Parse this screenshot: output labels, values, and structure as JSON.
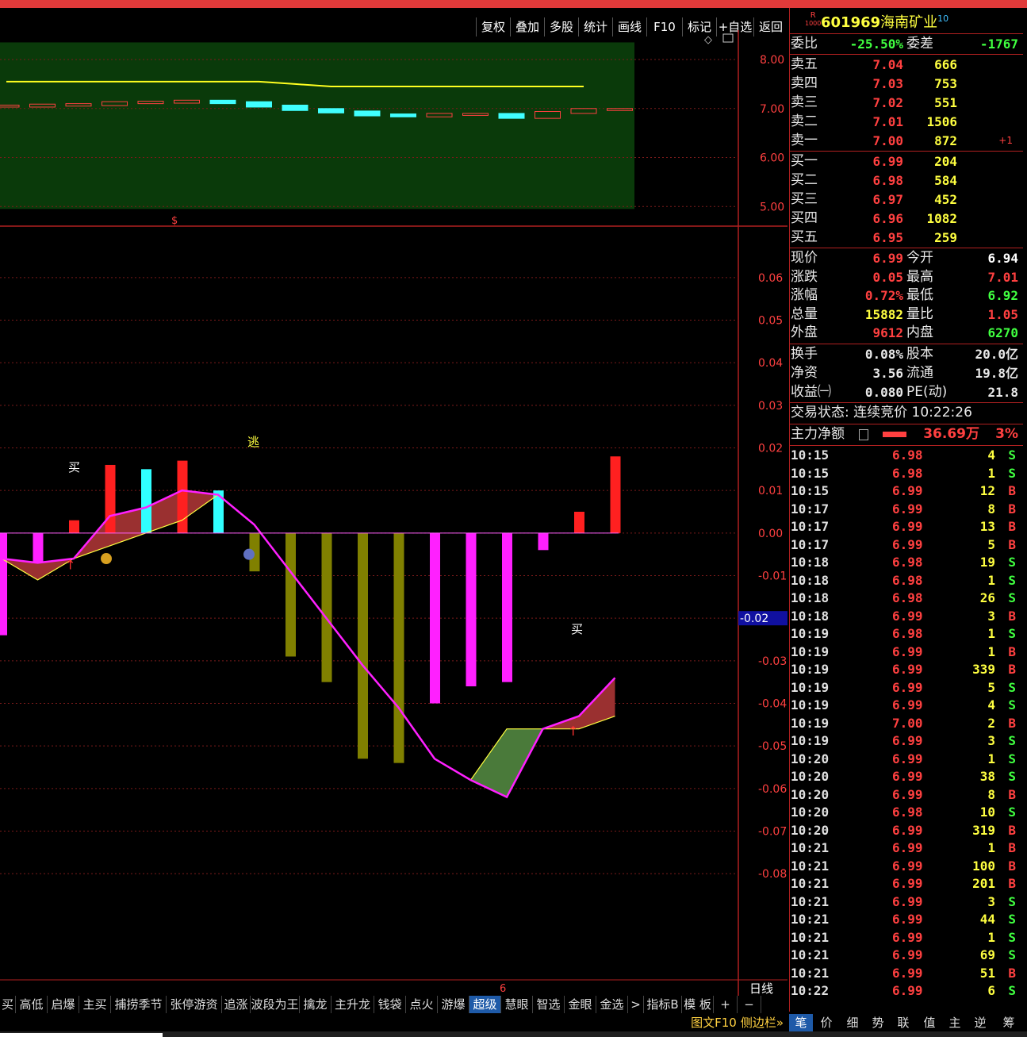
{
  "toolbar": {
    "buttons": [
      "复权",
      "叠加",
      "多股",
      "统计",
      "画线",
      "F10",
      "标记",
      "+自选",
      "返回"
    ]
  },
  "stock": {
    "badge_top": "R",
    "badge_bottom": "1000",
    "code": "601969",
    "name": "海南矿业",
    "superscript": "10"
  },
  "order_ratio": {
    "label1": "委比",
    "value1": "-25.50%",
    "label2": "委差",
    "value2": "-1767"
  },
  "asks": [
    {
      "label": "卖五",
      "price": "7.04",
      "vol": "666",
      "delta": ""
    },
    {
      "label": "卖四",
      "price": "7.03",
      "vol": "753",
      "delta": ""
    },
    {
      "label": "卖三",
      "price": "7.02",
      "vol": "551",
      "delta": ""
    },
    {
      "label": "卖二",
      "price": "7.01",
      "vol": "1506",
      "delta": ""
    },
    {
      "label": "卖一",
      "price": "7.00",
      "vol": "872",
      "delta": "+1"
    }
  ],
  "bids": [
    {
      "label": "买一",
      "price": "6.99",
      "vol": "204"
    },
    {
      "label": "买二",
      "price": "6.98",
      "vol": "584"
    },
    {
      "label": "买三",
      "price": "6.97",
      "vol": "452"
    },
    {
      "label": "买四",
      "price": "6.96",
      "vol": "1082"
    },
    {
      "label": "买五",
      "price": "6.95",
      "vol": "259"
    }
  ],
  "stats": [
    {
      "l1": "现价",
      "v1": "6.99",
      "c1": "#ff4040",
      "l2": "今开",
      "v2": "6.94",
      "c2": "#ffffff"
    },
    {
      "l1": "涨跌",
      "v1": "0.05",
      "c1": "#ff4040",
      "l2": "最高",
      "v2": "7.01",
      "c2": "#ff4040"
    },
    {
      "l1": "涨幅",
      "v1": "0.72%",
      "c1": "#ff4040",
      "l2": "最低",
      "v2": "6.92",
      "c2": "#40ff40"
    },
    {
      "l1": "总量",
      "v1": "15882",
      "c1": "#ffff40",
      "l2": "量比",
      "v2": "1.05",
      "c2": "#ff4040"
    },
    {
      "l1": "外盘",
      "v1": "9612",
      "c1": "#ff4040",
      "l2": "内盘",
      "v2": "6270",
      "c2": "#40ff40"
    }
  ],
  "stats2": [
    {
      "l1": "换手",
      "v1": "0.08%",
      "l2": "股本",
      "v2": "20.0亿"
    },
    {
      "l1": "净资",
      "v1": "3.56",
      "l2": "流通",
      "v2": "19.8亿"
    },
    {
      "l1": "收益㈠",
      "v1": "0.080",
      "l2": "PE(动)",
      "v2": "21.8"
    }
  ],
  "trade_status": "交易状态: 连续竞价 10:22:26",
  "main_force": {
    "label": "主力净额",
    "value": "36.69万",
    "pct": "3%"
  },
  "ticks": [
    [
      "10:15",
      "6.98",
      "4",
      "S"
    ],
    [
      "10:15",
      "6.98",
      "1",
      "S"
    ],
    [
      "10:15",
      "6.99",
      "12",
      "B"
    ],
    [
      "10:17",
      "6.99",
      "8",
      "B"
    ],
    [
      "10:17",
      "6.99",
      "13",
      "B"
    ],
    [
      "10:17",
      "6.99",
      "5",
      "B"
    ],
    [
      "10:18",
      "6.98",
      "19",
      "S"
    ],
    [
      "10:18",
      "6.98",
      "1",
      "S"
    ],
    [
      "10:18",
      "6.98",
      "26",
      "S"
    ],
    [
      "10:18",
      "6.99",
      "3",
      "B"
    ],
    [
      "10:19",
      "6.98",
      "1",
      "S"
    ],
    [
      "10:19",
      "6.99",
      "1",
      "B"
    ],
    [
      "10:19",
      "6.99",
      "339",
      "B"
    ],
    [
      "10:19",
      "6.99",
      "5",
      "S"
    ],
    [
      "10:19",
      "6.99",
      "4",
      "S"
    ],
    [
      "10:19",
      "7.00",
      "2",
      "B"
    ],
    [
      "10:19",
      "6.99",
      "3",
      "S"
    ],
    [
      "10:20",
      "6.99",
      "1",
      "S"
    ],
    [
      "10:20",
      "6.99",
      "38",
      "S"
    ],
    [
      "10:20",
      "6.99",
      "8",
      "B"
    ],
    [
      "10:20",
      "6.98",
      "10",
      "S"
    ],
    [
      "10:20",
      "6.99",
      "319",
      "B"
    ],
    [
      "10:21",
      "6.99",
      "1",
      "B"
    ],
    [
      "10:21",
      "6.99",
      "100",
      "B"
    ],
    [
      "10:21",
      "6.99",
      "201",
      "B"
    ],
    [
      "10:21",
      "6.99",
      "3",
      "S"
    ],
    [
      "10:21",
      "6.99",
      "44",
      "S"
    ],
    [
      "10:21",
      "6.99",
      "1",
      "S"
    ],
    [
      "10:21",
      "6.99",
      "69",
      "S"
    ],
    [
      "10:21",
      "6.99",
      "51",
      "B"
    ],
    [
      "10:22",
      "6.99",
      "6",
      "S"
    ]
  ],
  "chart_data": [
    {
      "type": "candlestick",
      "ylim": [
        4.6,
        8.6
      ],
      "yticks": [
        "8.00",
        "7.00",
        "6.00",
        "5.00"
      ],
      "closes": [
        7.05,
        7.07,
        7.08,
        7.12,
        7.13,
        7.15,
        7.12,
        7.05,
        6.98,
        6.93,
        6.87,
        6.85,
        6.88,
        6.88,
        6.82,
        6.92,
        6.98,
        6.98
      ],
      "ma_line": [
        7.55,
        7.55,
        7.55,
        7.55,
        7.55,
        7.55,
        7.55,
        7.55,
        7.5,
        7.45,
        7.45,
        7.45,
        7.45,
        7.45,
        7.45,
        7.45,
        7.45
      ],
      "marker": "$"
    },
    {
      "type": "bar",
      "ylim": [
        -0.09,
        0.07
      ],
      "yticks": [
        "0.06",
        "0.05",
        "0.04",
        "0.03",
        "0.02",
        "0.01",
        "0.00",
        "-0.01",
        "-0.02",
        "-0.03",
        "-0.04",
        "-0.05",
        "-0.06",
        "-0.07",
        "-0.08"
      ],
      "cursor_value": "-0.02",
      "bars": [
        -0.024,
        -0.007,
        0.003,
        0.016,
        0.015,
        0.017,
        0.01,
        -0.009,
        -0.029,
        -0.035,
        -0.053,
        -0.054,
        -0.04,
        -0.036,
        -0.035,
        -0.004,
        0.005,
        0.018
      ],
      "line_upper": [
        -0.006,
        -0.007,
        -0.006,
        0.004,
        0.006,
        0.01,
        0.009,
        0.002,
        -0.009,
        -0.02,
        -0.031,
        -0.041,
        -0.053,
        -0.058,
        -0.062,
        -0.046,
        -0.043,
        -0.034
      ],
      "line_lower": [
        -0.006,
        -0.011,
        -0.006,
        -0.003,
        0.0,
        0.003,
        0.009,
        0.002,
        -0.009,
        -0.02,
        -0.031,
        -0.041,
        -0.053,
        -0.058,
        -0.046,
        -0.046,
        -0.046,
        -0.043
      ],
      "annotations": {
        "buy1": "买",
        "escape": "逃",
        "buy2": "买"
      },
      "x_label": "6",
      "period": "日线"
    }
  ],
  "bottom_tabs": [
    "买",
    "高低",
    "启爆",
    "主买",
    "捕捞季节",
    "张停游资",
    "追涨",
    "波段为王",
    "擒龙",
    "主升龙",
    "钱袋",
    "点火",
    "游爆",
    "超级",
    "慧眼",
    "智选",
    "金眼",
    "金选",
    ">",
    "指标B",
    "模 板",
    "+",
    "−"
  ],
  "active_tab": "超级",
  "right_tabs": [
    "图文F10",
    "侧边栏»",
    "笔",
    "价",
    "细",
    "势",
    "联",
    "值",
    "主",
    "逆",
    "筹"
  ]
}
